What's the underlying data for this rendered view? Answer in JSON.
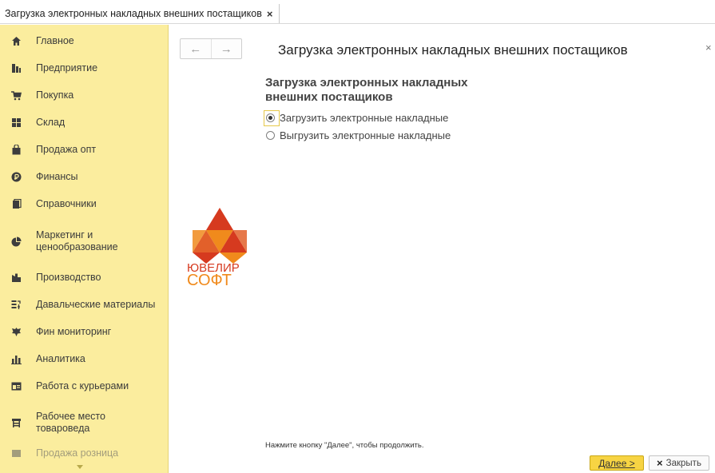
{
  "tab": {
    "title": "Загрузка электронных накладных внешних постащиков",
    "close_symbol": "×"
  },
  "sidebar": {
    "items": [
      {
        "label": "Главное",
        "icon": "home-icon"
      },
      {
        "label": "Предприятие",
        "icon": "enterprise-icon"
      },
      {
        "label": "Покупка",
        "icon": "cart-icon"
      },
      {
        "label": "Склад",
        "icon": "warehouse-icon"
      },
      {
        "label": "Продажа опт",
        "icon": "bag-icon"
      },
      {
        "label": "Финансы",
        "icon": "ruble-icon"
      },
      {
        "label": "Справочники",
        "icon": "catalog-icon"
      },
      {
        "label": "Маркетинг и\nценообразование",
        "icon": "pie-chart-icon"
      },
      {
        "label": "Производство",
        "icon": "factory-icon"
      },
      {
        "label": "Давальческие материалы",
        "icon": "materials-icon"
      },
      {
        "label": "Фин мониторинг",
        "icon": "emblem-icon"
      },
      {
        "label": "Аналитика",
        "icon": "bar-chart-icon"
      },
      {
        "label": "Работа с курьерами",
        "icon": "courier-icon"
      },
      {
        "label": "Рабочее место\nтовароведа",
        "icon": "workplace-icon"
      },
      {
        "label": "Продажа розница",
        "icon": "retail-icon"
      }
    ]
  },
  "nav": {
    "back": "←",
    "forward": "→"
  },
  "form": {
    "title": "Загрузка электронных накладных внешних постащиков",
    "close_symbol": "×",
    "heading": "Загрузка электронных накладных внешних постащиков",
    "options": [
      {
        "label": "Загрузить электронные накладные",
        "selected": true
      },
      {
        "label": "Выгрузить электронные накладные",
        "selected": false
      }
    ],
    "hint": "Нажмите кнопку \"Далее\", чтобы продолжить.",
    "next_label": "Далее >",
    "close_label": "Закрыть",
    "close_icon": "×"
  },
  "logo": {
    "line1": "ЮВЕЛИР",
    "line2": "СОФТ",
    "colors": [
      "#d63a1f",
      "#f08a1c",
      "#e2602a"
    ]
  }
}
